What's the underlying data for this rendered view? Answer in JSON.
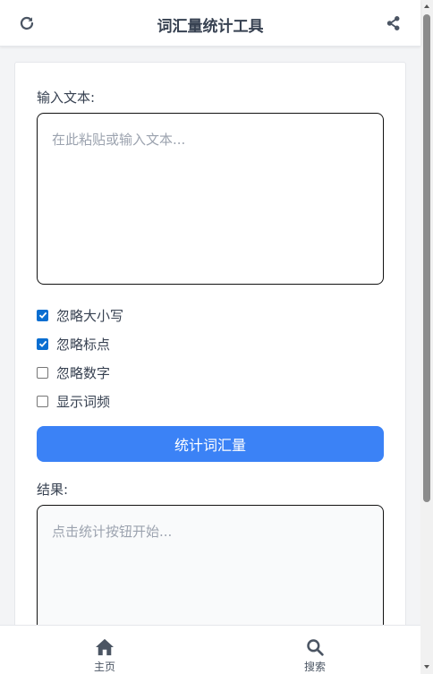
{
  "header": {
    "title": "词汇量统计工具",
    "refresh_icon": "refresh-icon",
    "share_icon": "share-icon"
  },
  "input": {
    "label": "输入文本:",
    "value": "",
    "placeholder": "在此粘贴或输入文本..."
  },
  "options": [
    {
      "label": "忽略大小写",
      "checked": true
    },
    {
      "label": "忽略标点",
      "checked": true
    },
    {
      "label": "忽略数字",
      "checked": false
    },
    {
      "label": "显示词频",
      "checked": false
    }
  ],
  "actions": {
    "count_label": "统计词汇量"
  },
  "result": {
    "label": "结果:",
    "placeholder": "点击统计按钮开始..."
  },
  "bottom_nav": [
    {
      "label": "主页",
      "icon": "home-icon"
    },
    {
      "label": "搜索",
      "icon": "search-icon"
    }
  ],
  "colors": {
    "primary": "#3b82f6",
    "checkbox": "#0a6ed1",
    "title_text": "#374151",
    "placeholder": "#9ca3af"
  }
}
